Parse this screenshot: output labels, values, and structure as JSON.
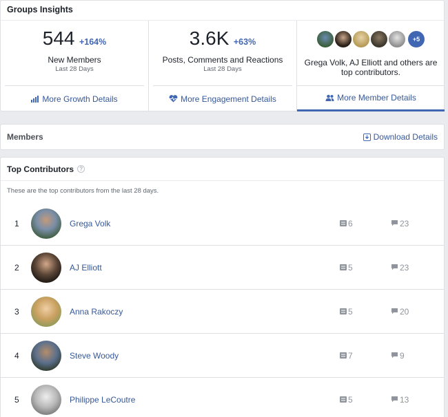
{
  "insights": {
    "title": "Groups Insights",
    "new_members": {
      "value": "544",
      "change": "+164%",
      "label": "New Members",
      "period": "Last 28 Days",
      "link": "More Growth Details"
    },
    "engagement": {
      "value": "3.6K",
      "change": "+63%",
      "label": "Posts, Comments and Reactions",
      "period": "Last 28 Days",
      "link": "More Engagement Details"
    },
    "contributors": {
      "more_count": "+5",
      "text": "Grega Volk, AJ Elliott and others are top contributors.",
      "link": "More Member Details"
    }
  },
  "members": {
    "title": "Members",
    "download_label": "Download Details"
  },
  "top_contributors": {
    "title": "Top Contributors",
    "help": "?",
    "description": "These are the top contributors from the last 28 days.",
    "rows": [
      {
        "rank": "1",
        "name": "Grega Volk",
        "posts": "6",
        "comments": "23"
      },
      {
        "rank": "2",
        "name": "AJ Elliott",
        "posts": "5",
        "comments": "23"
      },
      {
        "rank": "3",
        "name": "Anna Rakoczy",
        "posts": "5",
        "comments": "20"
      },
      {
        "rank": "4",
        "name": "Steve Woody",
        "posts": "7",
        "comments": "9"
      },
      {
        "rank": "5",
        "name": "Philippe LeCoutre",
        "posts": "5",
        "comments": "13"
      }
    ]
  },
  "colors": {
    "accent": "#4267b2",
    "link": "#365899",
    "muted": "#90949c",
    "background": "#e9ebee"
  }
}
